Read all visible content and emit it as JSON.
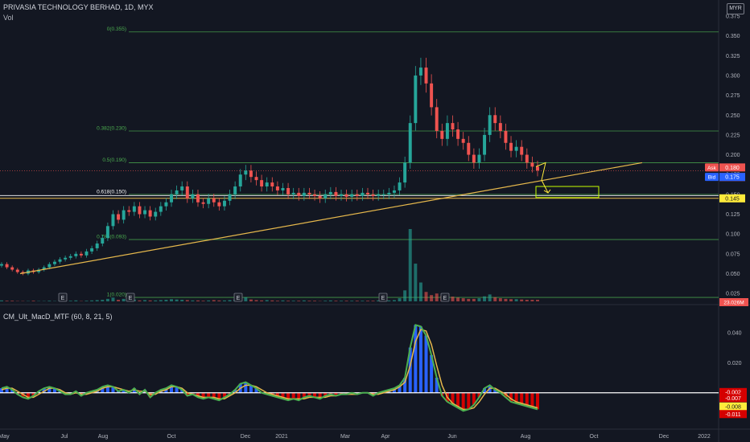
{
  "header": {
    "title": "PRIVASIA TECHNOLOGY BERHAD, 1D, MYX",
    "volume_label": "Vol",
    "currency": "MYR"
  },
  "macd_panel": {
    "title": "CM_Ult_MacD_MTF (60, 8, 21, 5)"
  },
  "colors": {
    "background": "#131722",
    "candle_up": "#26a69a",
    "candle_down": "#ef5350",
    "fib_line": "#4caf50",
    "trendline": "#e6b84c",
    "macd_line": "#4caf50",
    "signal_line": "#e6b84c",
    "histogram_up": "#2962ff",
    "histogram_down": "#d50000",
    "zero_line": "#ffffff",
    "ask": "#ef5350",
    "bid": "#2962ff",
    "support_label": "#ffeb3b"
  },
  "chart_data": [
    {
      "type": "candlestick",
      "y_axis_ticks": [
        "0.375",
        "0.350",
        "0.325",
        "0.300",
        "0.275",
        "0.250",
        "0.225",
        "0.200",
        "0.175",
        "0.150",
        "0.125",
        "0.100",
        "0.075",
        "0.050",
        "0.025"
      ],
      "ylim": [
        0.015,
        0.375
      ],
      "x_axis_ticks": [
        "May",
        "Jul",
        "Aug",
        "Oct",
        "Dec",
        "2021",
        "Mar",
        "Apr",
        "Jun",
        "Aug",
        "Oct",
        "Dec",
        "2022"
      ],
      "fib_levels": [
        {
          "label": "0(0.355)",
          "value": 0.355
        },
        {
          "label": "0.382(0.230)",
          "value": 0.23
        },
        {
          "label": "0.5(0.190)",
          "value": 0.19
        },
        {
          "label": "0.618(0.150)",
          "value": 0.15
        },
        {
          "label": "0.786(0.093)",
          "value": 0.093
        },
        {
          "label": "1(0.020)",
          "value": 0.02
        }
      ],
      "price_labels": [
        {
          "label": "Ask",
          "value": "0.180"
        },
        {
          "label": "",
          "value": "0.180"
        },
        {
          "label": "Bid",
          "value": "0.175"
        },
        {
          "label": "",
          "value": "0.145"
        }
      ],
      "support_level": 0.145,
      "volume_label": "23.026M",
      "event_markers": [
        "E",
        "E",
        "E",
        "E",
        "E"
      ],
      "closes": [
        0.062,
        0.058,
        0.055,
        0.052,
        0.05,
        0.054,
        0.052,
        0.055,
        0.058,
        0.062,
        0.065,
        0.068,
        0.07,
        0.072,
        0.075,
        0.073,
        0.078,
        0.082,
        0.088,
        0.095,
        0.11,
        0.125,
        0.118,
        0.13,
        0.128,
        0.135,
        0.125,
        0.13,
        0.122,
        0.128,
        0.135,
        0.14,
        0.15,
        0.155,
        0.16,
        0.145,
        0.15,
        0.14,
        0.138,
        0.145,
        0.14,
        0.135,
        0.142,
        0.15,
        0.16,
        0.175,
        0.18,
        0.172,
        0.168,
        0.16,
        0.165,
        0.16,
        0.155,
        0.158,
        0.15,
        0.152,
        0.148,
        0.152,
        0.15,
        0.148,
        0.145,
        0.15,
        0.153,
        0.148,
        0.15,
        0.147,
        0.15,
        0.148,
        0.152,
        0.15,
        0.148,
        0.15,
        0.15,
        0.152,
        0.155,
        0.165,
        0.19,
        0.24,
        0.3,
        0.31,
        0.29,
        0.26,
        0.23,
        0.22,
        0.24,
        0.232,
        0.22,
        0.215,
        0.2,
        0.19,
        0.2,
        0.225,
        0.25,
        0.24,
        0.23,
        0.215,
        0.205,
        0.21,
        0.2,
        0.19,
        0.185,
        0.18
      ],
      "volumes": [
        0.3,
        0.2,
        0.2,
        0.1,
        0.1,
        0.1,
        0.2,
        0.1,
        0.1,
        0.2,
        0.1,
        0.3,
        0.2,
        0.2,
        0.3,
        0.1,
        0.2,
        0.3,
        0.4,
        0.5,
        0.8,
        1.2,
        0.5,
        0.8,
        0.4,
        0.6,
        0.3,
        0.4,
        0.3,
        0.3,
        0.4,
        0.5,
        0.7,
        0.6,
        0.5,
        0.4,
        0.3,
        0.3,
        0.2,
        0.3,
        0.4,
        0.3,
        0.3,
        0.4,
        0.6,
        1.0,
        1.3,
        0.6,
        0.4,
        0.3,
        0.4,
        0.3,
        0.2,
        0.3,
        0.2,
        0.2,
        0.2,
        0.3,
        0.2,
        0.2,
        0.1,
        0.2,
        0.3,
        0.2,
        0.2,
        0.2,
        0.2,
        0.2,
        0.2,
        0.2,
        0.2,
        0.3,
        0.3,
        0.3,
        0.4,
        1.0,
        3.5,
        23.0,
        12.0,
        6.0,
        3.0,
        2.0,
        2.5,
        1.8,
        2.2,
        1.5,
        1.2,
        1.0,
        0.8,
        0.8,
        1.0,
        1.6,
        2.2,
        1.3,
        1.0,
        0.8,
        0.7,
        0.7,
        0.6,
        0.5,
        0.5,
        0.5
      ],
      "trendline_start": 0.05,
      "trendline_end": 0.19
    },
    {
      "type": "line",
      "name": "CM_Ult_MacD_MTF",
      "y_axis_ticks": [
        "0.040",
        "0.020"
      ],
      "ylim": [
        -0.022,
        0.05
      ],
      "value_labels": [
        "-0.002",
        "-0.007",
        "-0.008",
        "-0.011"
      ],
      "macd": [
        0.003,
        0.004,
        0.002,
        -0.001,
        -0.003,
        -0.004,
        -0.002,
        0.001,
        0.003,
        0.004,
        0.003,
        0.001,
        -0.001,
        -0.001,
        0.001,
        -0.002,
        0.0,
        0.001,
        0.002,
        0.004,
        0.005,
        0.004,
        0.001,
        0.002,
        0.0,
        0.003,
        -0.001,
        0.002,
        -0.003,
        0.0,
        0.002,
        0.003,
        0.005,
        0.004,
        0.002,
        -0.002,
        -0.001,
        -0.003,
        -0.004,
        -0.003,
        -0.004,
        -0.005,
        -0.003,
        -0.001,
        0.002,
        0.006,
        0.007,
        0.005,
        0.003,
        0.0,
        -0.001,
        -0.002,
        -0.003,
        -0.004,
        -0.005,
        -0.004,
        -0.005,
        -0.003,
        -0.002,
        -0.003,
        -0.004,
        -0.002,
        -0.001,
        -0.002,
        -0.001,
        -0.001,
        0.0,
        -0.001,
        0.0,
        0.0,
        -0.002,
        0.0,
        0.001,
        0.002,
        0.003,
        0.005,
        0.01,
        0.03,
        0.045,
        0.044,
        0.038,
        0.025,
        0.01,
        -0.002,
        -0.006,
        -0.008,
        -0.01,
        -0.012,
        -0.011,
        -0.008,
        -0.003,
        0.003,
        0.005,
        0.002,
        0.0,
        -0.003,
        -0.006,
        -0.007,
        -0.008,
        -0.009,
        -0.01,
        -0.011
      ],
      "signal": [
        0.002,
        0.003,
        0.003,
        0.001,
        -0.001,
        -0.003,
        -0.003,
        -0.001,
        0.001,
        0.003,
        0.003,
        0.002,
        0.0,
        -0.001,
        0.0,
        -0.001,
        -0.001,
        0.0,
        0.001,
        0.003,
        0.004,
        0.004,
        0.003,
        0.002,
        0.001,
        0.002,
        0.001,
        0.001,
        -0.001,
        -0.001,
        0.001,
        0.002,
        0.004,
        0.004,
        0.003,
        0.0,
        -0.001,
        -0.002,
        -0.003,
        -0.003,
        -0.003,
        -0.004,
        -0.004,
        -0.002,
        0.0,
        0.003,
        0.005,
        0.005,
        0.004,
        0.002,
        0.0,
        -0.001,
        -0.002,
        -0.003,
        -0.004,
        -0.004,
        -0.004,
        -0.004,
        -0.003,
        -0.003,
        -0.003,
        -0.003,
        -0.002,
        -0.002,
        -0.001,
        -0.001,
        -0.001,
        -0.001,
        0.0,
        0.0,
        -0.001,
        -0.001,
        0.0,
        0.001,
        0.002,
        0.004,
        0.007,
        0.018,
        0.034,
        0.042,
        0.041,
        0.032,
        0.018,
        0.005,
        -0.003,
        -0.007,
        -0.009,
        -0.011,
        -0.011,
        -0.01,
        -0.006,
        -0.001,
        0.003,
        0.003,
        0.001,
        -0.001,
        -0.004,
        -0.006,
        -0.007,
        -0.008,
        -0.009,
        -0.01
      ]
    }
  ]
}
